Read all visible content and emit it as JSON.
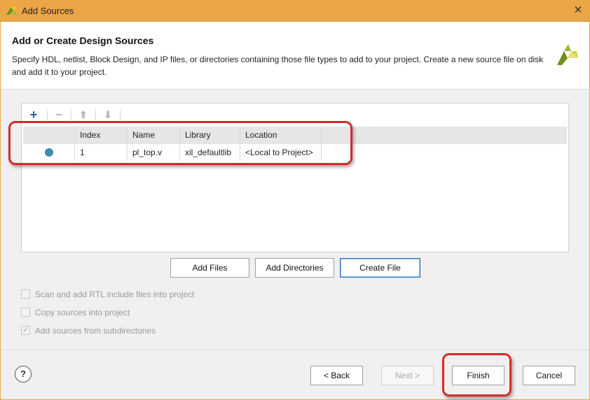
{
  "window": {
    "title": "Add Sources",
    "close_glyph": "✕"
  },
  "header": {
    "title": "Add or Create Design Sources",
    "description": "Specify HDL, netlist, Block Design, and IP files, or directories containing those file types to add to your project. Create a new source file on disk and add it to your project."
  },
  "toolbar": {
    "add_glyph": "+",
    "remove_glyph": "−",
    "up_glyph": "⬆",
    "down_glyph": "⬇"
  },
  "table": {
    "columns": [
      "",
      "Index",
      "Name",
      "Library",
      "Location"
    ],
    "rows": [
      {
        "status_color": "#3f8bb3",
        "index": "1",
        "name": "pl_top.v",
        "library": "xil_defaultlib",
        "location": "<Local to Project>"
      }
    ]
  },
  "buttons": {
    "add_files": "Add Files",
    "add_directories": "Add Directories",
    "create_file": "Create File"
  },
  "options": [
    {
      "label": "Scan and add RTL include files into project",
      "checked": false,
      "enabled": false
    },
    {
      "label": "Copy sources into project",
      "checked": false,
      "enabled": false
    },
    {
      "label": "Add sources from subdirectories",
      "checked": true,
      "enabled": false
    }
  ],
  "footer": {
    "help": "?",
    "back": "< Back",
    "next": "Next >",
    "finish": "Finish",
    "cancel": "Cancel"
  },
  "colors": {
    "title_bar": "#eba645",
    "highlight": "#d62a2a",
    "add_icon": "#1f5fa8"
  }
}
